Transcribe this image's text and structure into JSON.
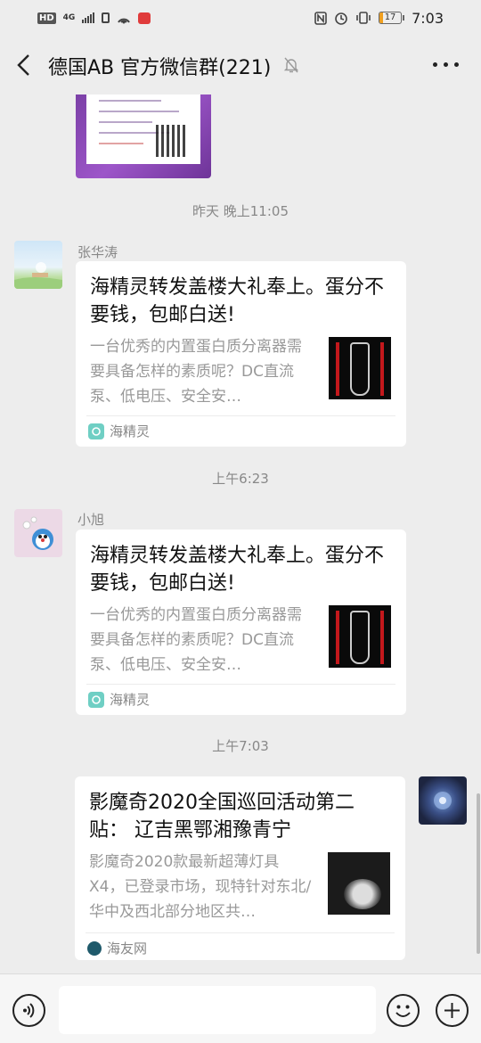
{
  "status_bar": {
    "hd": "HD",
    "network": "4G",
    "time": "7:03",
    "battery": "17"
  },
  "header": {
    "title": "德国AB  官方微信群(221)"
  },
  "chat": {
    "timestamps": [
      "昨天 晚上11:05",
      "上午6:23",
      "上午7:03"
    ],
    "messages": [
      {
        "sender": "张华涛",
        "title": "海精灵转发盖楼大礼奉上。蛋分不要钱，包邮白送!",
        "desc": "一台优秀的内置蛋白质分离器需要具备怎样的素质呢？DC直流泵、低电压、安全安…",
        "source": "海精灵"
      },
      {
        "sender": "小旭",
        "title": "海精灵转发盖楼大礼奉上。蛋分不要钱，包邮白送!",
        "desc": "一台优秀的内置蛋白质分离器需要具备怎样的素质呢？DC直流泵、低电压、安全安…",
        "source": "海精灵"
      },
      {
        "sender": "",
        "title": "影魔奇2020全国巡回活动第二贴：   辽吉黑鄂湘豫青宁",
        "desc": "影魔奇2020款最新超薄灯具X4，已登录市场，现特针对东北/华中及西北部分地区共…",
        "source": "海友网"
      }
    ]
  },
  "input_bar": {
    "placeholder": ""
  },
  "colors": {
    "background": "#ededed",
    "card": "#ffffff",
    "accent_battery": "#f0a020"
  }
}
